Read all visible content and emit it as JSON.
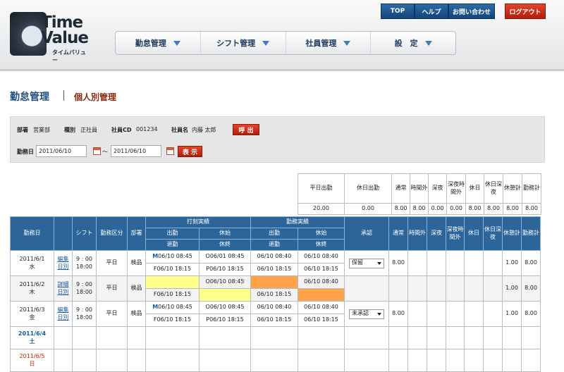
{
  "logo": {
    "word1": "Time",
    "word2": "Value",
    "kana": "タイムバリュー"
  },
  "top_nav": {
    "top": "TOP",
    "help": "ヘルプ",
    "contact": "お問い合わせ",
    "logout": "ログアウト"
  },
  "menu": [
    {
      "label": "勤怠管理"
    },
    {
      "label": "シフト管理"
    },
    {
      "label": "社員管理"
    },
    {
      "label": "設　定"
    }
  ],
  "page": {
    "title": "勤怠管理",
    "subtitle": "個人別管理"
  },
  "filter": {
    "dept_label": "部署",
    "dept_value": "営業部",
    "type_label": "種別",
    "type_value": "正社員",
    "cd_label": "社員CD",
    "cd_value": "001234",
    "name_label": "社員名",
    "name_value": "内藤 太郎",
    "call_button": "呼 出",
    "date_label": "勤務日",
    "date_from": "2011/06/10",
    "tilde": "～",
    "date_to": "2011/06/10",
    "show_button": "表 示"
  },
  "summary": {
    "headers": [
      "平日出勤",
      "休日出勤",
      "通常",
      "時間外",
      "深夜",
      "深夜時間外",
      "休日",
      "休日深夜",
      "休憩計",
      "勤務計"
    ],
    "values": [
      "20.00",
      "0.00",
      "8.00",
      "8.00",
      "0.00",
      "0.00",
      "8.00",
      "8.00",
      "8.00",
      "8.00"
    ]
  },
  "table": {
    "headers": {
      "date": "勤務日",
      "shift": "シフト",
      "kubun": "勤務区分",
      "dept": "部署",
      "dakoku": "打刻実績",
      "kinmu": "勤務実績",
      "out": "出勤",
      "rest": "休始",
      "leave": "退勤",
      "rest_end": "休終",
      "approve": "承認",
      "normal": "通常",
      "overtime": "時間外",
      "night": "深夜",
      "night_ot": "深夜時間外",
      "holiday": "休日",
      "holiday_night": "休日深夜",
      "break_total": "休憩計",
      "work_total": "勤務計"
    },
    "rows": [
      {
        "date": "2011/6/1",
        "dow": "水",
        "link1": "編集",
        "link2": "日別",
        "shift_start": "9 : 00",
        "shift_end": "18:00",
        "kubun": "平日",
        "dept": "検品",
        "mark": "M",
        "in": "06/10 08:45",
        "rest_start": "O06/01 08:45",
        "out": "F06/10 18:15",
        "rest_end": "P06/10 18:15",
        "k_in": "06/10 08:40",
        "k_rest_start": "06/10 08:40",
        "k_out": "06/10 18:15",
        "k_rest_end": "06/10 18:15",
        "status": "保留",
        "normal": "8.00",
        "break_total": "1.00",
        "work_total": "8.00"
      },
      {
        "date": "2011/6/2",
        "dow": "木",
        "link1": "詳細",
        "link2": "日別",
        "shift_start": "9 : 00",
        "shift_end": "18:00",
        "kubun": "平日",
        "dept": "検品",
        "mark": "",
        "in": "",
        "rest_start": "O06/10 08:45",
        "out": "F06/10 18:15",
        "rest_end": "",
        "k_in": "",
        "k_rest_start": "06/10 08:40",
        "k_out": "06/10 18:15",
        "k_rest_end": "",
        "status": "",
        "normal": "",
        "break_total": "1.00",
        "work_total": "8.00"
      },
      {
        "date": "2011/6/3",
        "dow": "金",
        "link1": "編集",
        "link2": "日別",
        "shift_start": "9 : 00",
        "shift_end": "18:00",
        "kubun": "平日",
        "dept": "検品",
        "mark": "M",
        "in": "06/10 08:45",
        "rest_start": "O06/10 08:45",
        "out": "F06/10 18:15",
        "rest_end": "P06/10 18:15",
        "k_in": "06/10 08:40",
        "k_rest_start": "06/10 08:40",
        "k_out": "06/10 18:15",
        "k_rest_end": "06/10 18:15",
        "status": "未承認",
        "normal": "8.00",
        "break_total": "1.00",
        "work_total": "8.00"
      },
      {
        "date": "2011/6/4",
        "dow": "土"
      },
      {
        "date": "2011/6/5",
        "dow": "日"
      }
    ]
  },
  "colors": {
    "brand_blue": "#2b6599",
    "accent_red": "#c8260f",
    "missing_yellow": "#ffff8c",
    "missing_orange": "#ffa24a"
  }
}
